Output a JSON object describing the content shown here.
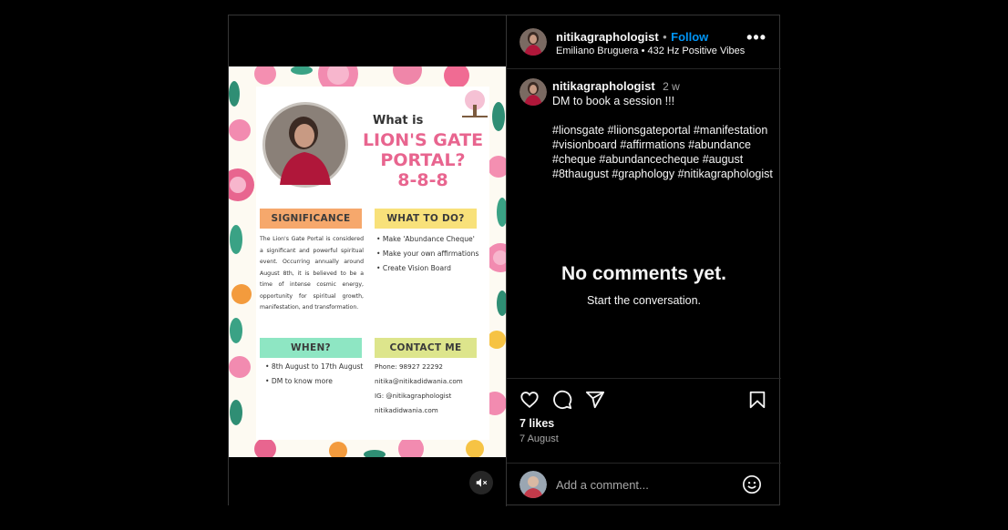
{
  "post": {
    "username": "nitikagraphologist",
    "follow_label": "Follow",
    "separator": "•",
    "audio_artist": "Emiliano Bruguera",
    "audio_separator": "•",
    "audio_title": "432 Hz Positive Vibes",
    "more_icon": "more-horizontal-icon",
    "caption_time": "2 w",
    "caption_text": "DM to book a session !!!\n\n#lionsgate #liionsgateportal #manifestation #visionboard #affirmations #abundance #cheque #abundancecheque #august #8thaugust #graphology #nitikagraphologist",
    "no_comments_title": "No comments yet.",
    "no_comments_sub": "Start the conversation.",
    "likes": "7 likes",
    "date": "7 August",
    "comment_placeholder": "Add a comment...",
    "action_icons": [
      "heart-icon",
      "comment-icon",
      "share-icon",
      "bookmark-icon"
    ],
    "mute_icon": "muted-speaker-icon",
    "emoji_icon": "emoji-icon"
  },
  "poster": {
    "heading_small": "What is",
    "heading_big_1": "LION'S GATE",
    "heading_big_2": "PORTAL?",
    "heading_big_3": "8-8-8",
    "significance_label": "SIGNIFICANCE",
    "significance_text": "The Lion's Gate Portal is considered a significant and powerful spiritual event. Occurring annually around August 8th, it is believed to be a time of intense cosmic energy, opportunity for spiritual growth, manifestation, and transformation.",
    "what_label": "WHAT TO DO?",
    "what_items": [
      "Make 'Abundance Cheque'",
      "Make your own affirmations",
      "Create Vision Board"
    ],
    "when_label": "WHEN?",
    "when_items": [
      "8th August to 17th August",
      "DM to know more"
    ],
    "contact_label": "CONTACT ME",
    "contact_lines": [
      "Phone: 98927 22292",
      "nitika@nitikadidwania.com",
      "IG: @nitikagraphologist",
      "nitikadidwania.com"
    ],
    "colors": {
      "pink": "#e8658f",
      "orange": "#f6a86c",
      "yellow": "#f8e17a",
      "mint": "#8ee6c3",
      "lime": "#dde58c"
    }
  }
}
